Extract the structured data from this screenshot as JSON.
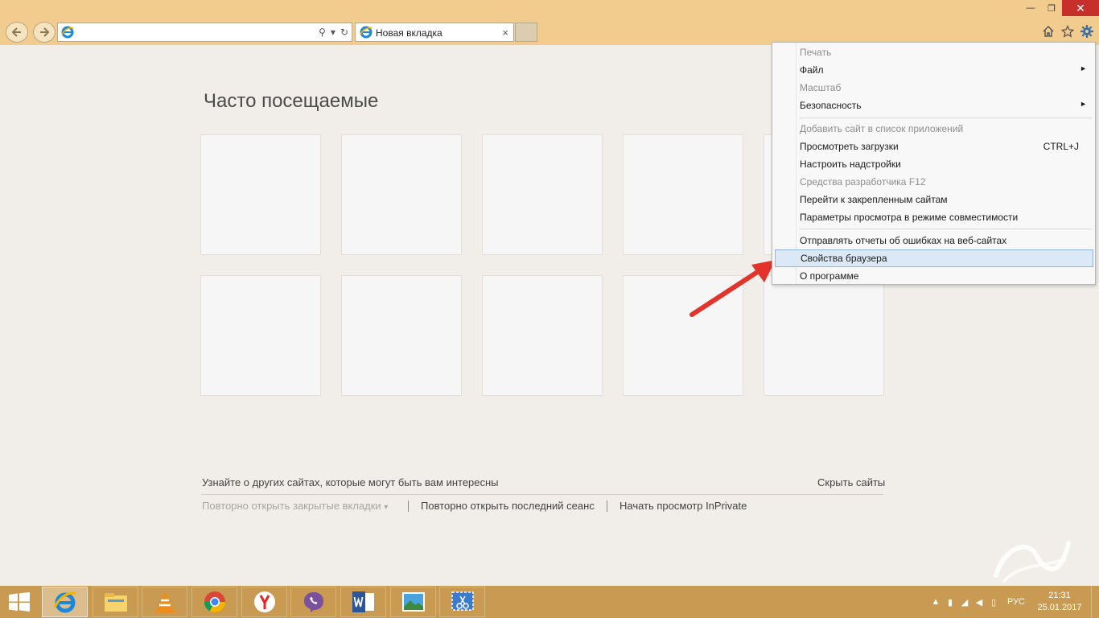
{
  "tab": {
    "title": "Новая вкладка",
    "close": "×"
  },
  "address": {
    "value": "",
    "search_glyph": "⚲",
    "dropdown_glyph": "▾",
    "refresh_glyph": "↻"
  },
  "window_controls": {
    "minimize": "—",
    "maximize": "❐",
    "close": "✕"
  },
  "toolbar": {
    "home_icon": "home-icon",
    "favorites_icon": "star-icon",
    "tools_icon": "gear-icon"
  },
  "page": {
    "title": "Часто посещаемые",
    "discover_text": "Узнайте о других сайтах, которые могут быть вам интересны",
    "hide_sites": "Скрыть сайты",
    "reopen_closed": "Повторно открыть закрытые вкладки",
    "reopen_closed_arrow": "▾",
    "reopen_session": "Повторно открыть последний сеанс",
    "inprivate": "Начать просмотр InPrivate"
  },
  "menu": {
    "items": [
      {
        "label": "Печать",
        "disabled": true
      },
      {
        "label": "Файл",
        "submenu": true
      },
      {
        "label": "Масштаб",
        "disabled": true
      },
      {
        "label": "Безопасность",
        "submenu": true
      },
      {
        "label": "Добавить сайт в список приложений",
        "disabled": true
      },
      {
        "label": "Просмотреть загрузки",
        "shortcut": "CTRL+J"
      },
      {
        "label": "Настроить надстройки"
      },
      {
        "label": "Средства разработчика F12",
        "disabled": true
      },
      {
        "label": "Перейти к закрепленным сайтам"
      },
      {
        "label": "Параметры просмотра в режиме совместимости"
      },
      {
        "label": "Отправлять отчеты об ошибках на веб-сайтах"
      },
      {
        "label": "Свойства браузера",
        "highlighted": true
      },
      {
        "label": "О программе"
      }
    ],
    "submenu_arrow": "►"
  },
  "taskbar": {
    "apps": [
      "internet-explorer",
      "file-explorer",
      "vlc",
      "chrome",
      "yandex-browser",
      "viber",
      "word",
      "photos",
      "snipping-tool"
    ],
    "lang": "РУС",
    "time": "21:31",
    "date": "25.01.2017"
  },
  "colors": {
    "chrome": "#f2cc8f",
    "taskbar": "#c99b52",
    "page": "#f1ede8",
    "arrow": "#e2342b",
    "highlight": "#dbe9f7"
  }
}
